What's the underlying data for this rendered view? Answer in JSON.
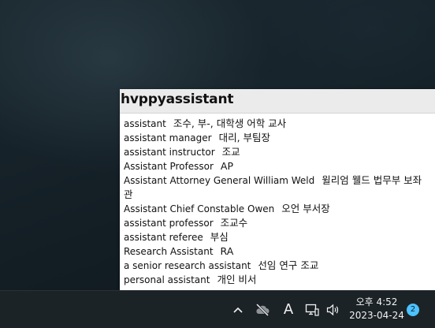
{
  "popup": {
    "title": "hvppyassistant",
    "entries": [
      {
        "term": "assistant",
        "meaning": "조수, 부-, 대학생 어학 교사"
      },
      {
        "term": "assistant manager",
        "meaning": "대리, 부팀장"
      },
      {
        "term": "assistant instructor",
        "meaning": "조교"
      },
      {
        "term": "Assistant Professor",
        "meaning": "AP"
      },
      {
        "term": "Assistant Attorney General William Weld",
        "meaning": "윌리엄 웰드 법무부 보좌관"
      },
      {
        "term": "Assistant Chief Constable Owen",
        "meaning": "오언 부서장"
      },
      {
        "term": "assistant professor",
        "meaning": "조교수"
      },
      {
        "term": "assistant referee",
        "meaning": "부심"
      },
      {
        "term": "Research Assistant",
        "meaning": "RA"
      },
      {
        "term": "a senior research assistant",
        "meaning": "선임 연구 조교"
      },
      {
        "term": "personal assistant",
        "meaning": "개인 비서"
      }
    ]
  },
  "taskbar": {
    "tray_chevron": "^",
    "ime_indicator": "A",
    "clock": {
      "time": "오후 4:52",
      "date": "2023-04-24"
    },
    "notification_count": "2",
    "icons": [
      "chevron-up-icon",
      "cloud-offline-icon",
      "ime-icon",
      "network-icon",
      "volume-icon"
    ]
  }
}
